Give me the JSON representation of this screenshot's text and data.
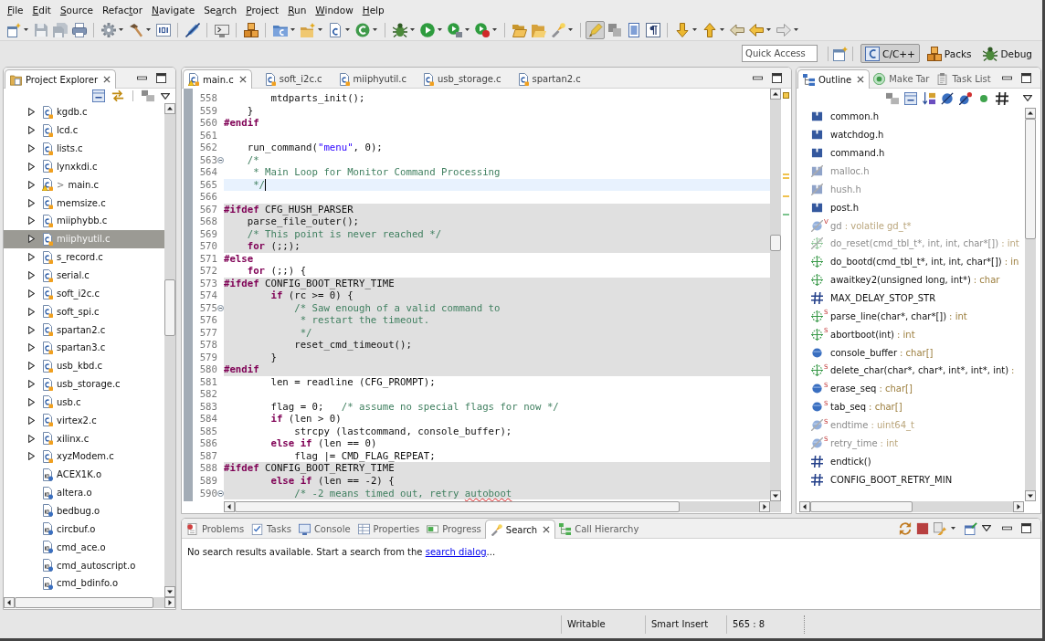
{
  "menu": [
    {
      "key": "F",
      "after": "ile"
    },
    {
      "key": "E",
      "after": "dit"
    },
    {
      "key": "S",
      "after": "ource"
    },
    {
      "before": "Refac",
      "key": "t",
      "after": "or"
    },
    {
      "key": "N",
      "after": "avigate"
    },
    {
      "before": "Se",
      "key": "a",
      "after": "rch"
    },
    {
      "key": "P",
      "after": "roject"
    },
    {
      "key": "R",
      "after": "un"
    },
    {
      "key": "W",
      "after": "indow"
    },
    {
      "key": "H",
      "after": "elp"
    }
  ],
  "toolbar": {
    "groups": [
      [
        {
          "kind": "new",
          "menu": true,
          "on": false
        },
        {
          "kind": "save",
          "menu": false,
          "on": false
        },
        {
          "kind": "saveall",
          "menu": false,
          "on": false
        },
        {
          "kind": "print",
          "menu": false,
          "on": false
        }
      ],
      [
        {
          "kind": "gear",
          "menu": true,
          "on": false
        },
        {
          "kind": "hammer",
          "menu": true,
          "on": false
        },
        {
          "kind": "binary",
          "menu": false,
          "on": false
        }
      ],
      [
        {
          "kind": "skip",
          "menu": false,
          "on": false
        }
      ],
      [
        {
          "kind": "remote",
          "menu": false,
          "on": false
        }
      ],
      [
        {
          "kind": "packs",
          "menu": false,
          "on": false
        }
      ],
      [
        {
          "kind": "cproject",
          "menu": true,
          "on": false
        },
        {
          "kind": "newfolder",
          "menu": true,
          "on": false
        },
        {
          "kind": "csource",
          "menu": true,
          "on": false
        },
        {
          "kind": "cclass",
          "menu": true,
          "on": false
        }
      ],
      [
        {
          "kind": "bug",
          "menu": true,
          "on": false
        },
        {
          "kind": "run",
          "menu": true,
          "on": false
        },
        {
          "kind": "runtool",
          "menu": true,
          "on": false
        },
        {
          "kind": "external",
          "menu": true,
          "on": false
        }
      ],
      [
        {
          "kind": "openfolder",
          "menu": false,
          "on": false
        },
        {
          "kind": "openfile",
          "menu": false,
          "on": false
        },
        {
          "kind": "torch",
          "menu": true,
          "on": false
        }
      ],
      [
        {
          "kind": "highlight",
          "menu": false,
          "on": true
        },
        {
          "kind": "block",
          "menu": false,
          "on": false
        },
        {
          "kind": "doc",
          "menu": false,
          "on": false
        },
        {
          "kind": "pilcrow",
          "menu": false,
          "on": false
        }
      ],
      [
        {
          "kind": "nextmark",
          "menu": true,
          "on": false
        },
        {
          "kind": "prevmark",
          "menu": true,
          "on": false
        },
        {
          "kind": "lastedit",
          "menu": false,
          "on": false
        },
        {
          "kind": "back",
          "menu": true,
          "on": false
        },
        {
          "kind": "forward",
          "menu": true,
          "on": false
        }
      ]
    ]
  },
  "quick_access": {
    "placeholder": "Quick Access"
  },
  "perspectives": [
    {
      "label": "C/C++",
      "kind": "c",
      "selected": true
    },
    {
      "label": "Packs",
      "kind": "packs",
      "selected": false
    },
    {
      "label": "Debug",
      "kind": "debug",
      "selected": false
    }
  ],
  "project_explorer": {
    "tabs": [
      {
        "label": "Project Explorer",
        "kind": "explorer",
        "selected": true
      }
    ],
    "items": [
      {
        "label": "kgdb.c",
        "kind": "source",
        "expanded": false,
        "warning": false,
        "selected": false
      },
      {
        "label": "lcd.c",
        "kind": "source",
        "expanded": false,
        "warning": false,
        "selected": false
      },
      {
        "label": "lists.c",
        "kind": "source",
        "expanded": false,
        "warning": false,
        "selected": false
      },
      {
        "label": "lynxkdi.c",
        "kind": "source",
        "expanded": false,
        "warning": false,
        "selected": false
      },
      {
        "prefix": ">",
        "label": "main.c",
        "kind": "source",
        "expanded": false,
        "warning": true,
        "selected": false
      },
      {
        "label": "memsize.c",
        "kind": "source",
        "expanded": false,
        "warning": false,
        "selected": false
      },
      {
        "label": "miiphybb.c",
        "kind": "source",
        "expanded": false,
        "warning": false,
        "selected": false
      },
      {
        "label": "miiphyutil.c",
        "kind": "source",
        "expanded": false,
        "warning": false,
        "selected": true
      },
      {
        "label": "s_record.c",
        "kind": "source",
        "expanded": false,
        "warning": false,
        "selected": false
      },
      {
        "label": "serial.c",
        "kind": "source",
        "expanded": false,
        "warning": false,
        "selected": false
      },
      {
        "label": "soft_i2c.c",
        "kind": "source",
        "expanded": false,
        "warning": false,
        "selected": false
      },
      {
        "label": "soft_spi.c",
        "kind": "source",
        "expanded": false,
        "warning": false,
        "selected": false
      },
      {
        "label": "spartan2.c",
        "kind": "source",
        "expanded": false,
        "warning": false,
        "selected": false
      },
      {
        "label": "spartan3.c",
        "kind": "source",
        "expanded": false,
        "warning": false,
        "selected": false
      },
      {
        "label": "usb_kbd.c",
        "kind": "source",
        "expanded": false,
        "warning": false,
        "selected": false
      },
      {
        "label": "usb_storage.c",
        "kind": "source",
        "expanded": false,
        "warning": false,
        "selected": false
      },
      {
        "label": "usb.c",
        "kind": "source",
        "expanded": false,
        "warning": false,
        "selected": false
      },
      {
        "label": "virtex2.c",
        "kind": "source",
        "expanded": false,
        "warning": false,
        "selected": false
      },
      {
        "label": "xilinx.c",
        "kind": "source",
        "expanded": false,
        "warning": false,
        "selected": false
      },
      {
        "label": "xyzModem.c",
        "kind": "source",
        "expanded": false,
        "warning": false,
        "selected": false
      },
      {
        "label": "ACEX1K.o",
        "kind": "object",
        "warning": false,
        "selected": false
      },
      {
        "label": "altera.o",
        "kind": "object",
        "warning": false,
        "selected": false
      },
      {
        "label": "bedbug.o",
        "kind": "object",
        "warning": false,
        "selected": false
      },
      {
        "label": "circbuf.o",
        "kind": "object",
        "warning": false,
        "selected": false
      },
      {
        "label": "cmd_ace.o",
        "kind": "object",
        "warning": false,
        "selected": false
      },
      {
        "label": "cmd_autoscript.o",
        "kind": "object",
        "warning": false,
        "selected": false
      },
      {
        "label": "cmd_bdinfo.o",
        "kind": "object",
        "warning": false,
        "selected": false
      }
    ]
  },
  "editor": {
    "tabs": [
      {
        "label": "main.c",
        "warning": true,
        "selected": true
      },
      {
        "label": "soft_i2c.c",
        "warning": false,
        "selected": false
      },
      {
        "label": "miiphyutil.c",
        "warning": false,
        "selected": false
      },
      {
        "label": "usb_storage.c",
        "warning": false,
        "selected": false
      },
      {
        "label": "spartan2.c",
        "warning": false,
        "selected": false
      }
    ],
    "lines": [
      {
        "number": "558",
        "segments": [
          {
            "kind": "plain",
            "text": "        mtdparts_init();"
          }
        ],
        "inactive": false,
        "current": false,
        "fold": false
      },
      {
        "number": "559",
        "segments": [
          {
            "kind": "plain",
            "text": "    }"
          }
        ],
        "inactive": false,
        "current": false,
        "fold": false
      },
      {
        "number": "560",
        "segments": [
          {
            "kind": "keyword",
            "text": "#endif"
          }
        ],
        "inactive": false,
        "current": false,
        "fold": false
      },
      {
        "number": "561",
        "inactive": false,
        "current": false,
        "fold": false
      },
      {
        "number": "562",
        "segments": [
          {
            "kind": "plain",
            "text": "    run_command("
          },
          {
            "kind": "string",
            "text": "\"menu\""
          },
          {
            "kind": "plain",
            "text": ", 0);"
          }
        ],
        "inactive": false,
        "current": false,
        "fold": false
      },
      {
        "number": "563",
        "segments": [
          {
            "kind": "comment",
            "text": "    /*"
          }
        ],
        "inactive": false,
        "current": false,
        "fold": true
      },
      {
        "number": "564",
        "segments": [
          {
            "kind": "comment",
            "text": "     * Main Loop for Monitor Command Processing"
          }
        ],
        "inactive": false,
        "current": false,
        "fold": false
      },
      {
        "number": "565",
        "segments": [
          {
            "kind": "comment",
            "text": "     */"
          }
        ],
        "inactive": false,
        "current": true,
        "fold": false
      },
      {
        "number": "566",
        "inactive": false,
        "current": false,
        "fold": false
      },
      {
        "number": "567",
        "segments": [
          {
            "kind": "keyword",
            "text": "#ifdef"
          },
          {
            "kind": "plain",
            "text": " CFG_HUSH_PARSER"
          }
        ],
        "inactive": true,
        "current": false,
        "fold": false
      },
      {
        "number": "568",
        "segments": [
          {
            "kind": "plain",
            "text": "    parse_file_outer();"
          }
        ],
        "inactive": true,
        "current": false,
        "fold": false
      },
      {
        "number": "569",
        "segments": [
          {
            "kind": "comment",
            "text": "    /* This point is never reached */"
          }
        ],
        "inactive": true,
        "current": false,
        "fold": false
      },
      {
        "number": "570",
        "segments": [
          {
            "kind": "keyword",
            "text": "    for"
          },
          {
            "kind": "plain",
            "text": " (;;);"
          }
        ],
        "inactive": true,
        "current": false,
        "fold": false
      },
      {
        "number": "571",
        "segments": [
          {
            "kind": "keyword",
            "text": "#else"
          }
        ],
        "inactive": false,
        "current": false,
        "fold": false
      },
      {
        "number": "572",
        "segments": [
          {
            "kind": "keyword",
            "text": "    for"
          },
          {
            "kind": "plain",
            "text": " (;;) {"
          }
        ],
        "inactive": false,
        "current": false,
        "fold": false
      },
      {
        "number": "573",
        "segments": [
          {
            "kind": "keyword",
            "text": "#ifdef"
          },
          {
            "kind": "plain",
            "text": " CONFIG_BOOT_RETRY_TIME"
          }
        ],
        "inactive": true,
        "current": false,
        "fold": false
      },
      {
        "number": "574",
        "segments": [
          {
            "kind": "keyword",
            "text": "        if"
          },
          {
            "kind": "plain",
            "text": " (rc >= 0) {"
          }
        ],
        "inactive": true,
        "current": false,
        "fold": false
      },
      {
        "number": "575",
        "segments": [
          {
            "kind": "comment",
            "text": "            /* Saw enough of a valid command to"
          }
        ],
        "inactive": true,
        "current": false,
        "fold": true
      },
      {
        "number": "576",
        "segments": [
          {
            "kind": "comment",
            "text": "             * restart the timeout."
          }
        ],
        "inactive": true,
        "current": false,
        "fold": false
      },
      {
        "number": "577",
        "segments": [
          {
            "kind": "comment",
            "text": "             */"
          }
        ],
        "inactive": true,
        "current": false,
        "fold": false
      },
      {
        "number": "578",
        "segments": [
          {
            "kind": "plain",
            "text": "            reset_cmd_timeout();"
          }
        ],
        "inactive": true,
        "current": false,
        "fold": false
      },
      {
        "number": "579",
        "segments": [
          {
            "kind": "plain",
            "text": "        }"
          }
        ],
        "inactive": true,
        "current": false,
        "fold": false
      },
      {
        "number": "580",
        "segments": [
          {
            "kind": "keyword",
            "text": "#endif"
          }
        ],
        "inactive": true,
        "current": false,
        "fold": false
      },
      {
        "number": "581",
        "segments": [
          {
            "kind": "plain",
            "text": "        len = readline (CFG_PROMPT);"
          }
        ],
        "inactive": false,
        "current": false,
        "fold": false
      },
      {
        "number": "582",
        "inactive": false,
        "current": false,
        "fold": false
      },
      {
        "number": "583",
        "segments": [
          {
            "kind": "plain",
            "text": "        flag = 0;   "
          },
          {
            "kind": "comment",
            "text": "/* assume no special flags for now */"
          }
        ],
        "inactive": false,
        "current": false,
        "fold": false
      },
      {
        "number": "584",
        "segments": [
          {
            "kind": "keyword",
            "text": "        if"
          },
          {
            "kind": "plain",
            "text": " (len > 0)"
          }
        ],
        "inactive": false,
        "current": false,
        "fold": false
      },
      {
        "number": "585",
        "segments": [
          {
            "kind": "plain",
            "text": "            strcpy (lastcommand, console_buffer);"
          }
        ],
        "inactive": false,
        "current": false,
        "fold": false
      },
      {
        "number": "586",
        "segments": [
          {
            "kind": "keyword",
            "text": "        else if"
          },
          {
            "kind": "plain",
            "text": " (len == 0)"
          }
        ],
        "inactive": false,
        "current": false,
        "fold": false
      },
      {
        "number": "587",
        "segments": [
          {
            "kind": "plain",
            "text": "            flag |= CMD_FLAG_REPEAT;"
          }
        ],
        "inactive": false,
        "current": false,
        "fold": false
      },
      {
        "number": "588",
        "segments": [
          {
            "kind": "keyword",
            "text": "#ifdef"
          },
          {
            "kind": "plain",
            "text": " CONFIG_BOOT_RETRY_TIME"
          }
        ],
        "inactive": true,
        "current": false,
        "fold": false
      },
      {
        "number": "589",
        "segments": [
          {
            "kind": "keyword",
            "text": "        else if"
          },
          {
            "kind": "plain",
            "text": " (len == -2) {"
          }
        ],
        "inactive": true,
        "current": false,
        "fold": false
      },
      {
        "number": "590",
        "segments": [
          {
            "kind": "comment",
            "text": "            /* -2 means timed out, retry "
          },
          {
            "kind": "misspelled",
            "text": "autoboot"
          }
        ],
        "inactive": true,
        "current": false,
        "fold": true
      }
    ],
    "overview_marks": [
      {
        "color": "#f0c24e"
      },
      {
        "color": "#f0c24e"
      },
      {
        "color": "#f0c24e"
      },
      {
        "color": "#7cc48e"
      }
    ]
  },
  "outline": {
    "tabs": [
      {
        "label": "Outline",
        "kind": "outline",
        "selected": true
      },
      {
        "label": "Make Tar",
        "kind": "make",
        "selected": false
      },
      {
        "label": "Task List",
        "kind": "tasklist",
        "selected": false
      }
    ],
    "items": [
      {
        "kind": "include",
        "name": "common.h",
        "inactive": false
      },
      {
        "kind": "include",
        "name": "watchdog.h",
        "inactive": false
      },
      {
        "kind": "include",
        "name": "command.h",
        "inactive": false
      },
      {
        "kind": "include",
        "name": "malloc.h",
        "inactive": true
      },
      {
        "kind": "include",
        "name": "hush.h",
        "inactive": true
      },
      {
        "kind": "include",
        "name": "post.h",
        "inactive": false
      },
      {
        "kind": "variable",
        "modifier": "V",
        "name": "gd",
        "type": ": volatile gd_t*",
        "inactive": true
      },
      {
        "kind": "function",
        "name": "do_reset(cmd_tbl_t*, int, int, char*[])",
        "type": ": int",
        "inactive": true
      },
      {
        "kind": "function",
        "name": "do_bootd(cmd_tbl_t*, int, int, char*[])",
        "type": ": in",
        "inactive": false
      },
      {
        "kind": "function",
        "name": "awaitkey2(unsigned long, int*)",
        "type": ": char",
        "inactive": false
      },
      {
        "kind": "macro",
        "name": "MAX_DELAY_STOP_STR",
        "inactive": false
      },
      {
        "kind": "function",
        "modifier": "S",
        "name": "parse_line(char*, char*[])",
        "type": ": int",
        "inactive": false
      },
      {
        "kind": "function",
        "modifier": "S",
        "name": "abortboot(int)",
        "type": ": int",
        "inactive": false
      },
      {
        "kind": "variable",
        "name": "console_buffer",
        "type": ": char[]",
        "inactive": false
      },
      {
        "kind": "function",
        "modifier": "S",
        "name": "delete_char(char*, char*, int*, int*, int)",
        "type": ":",
        "inactive": false
      },
      {
        "kind": "variable",
        "modifier": "S",
        "name": "erase_seq",
        "type": ": char[]",
        "inactive": false
      },
      {
        "kind": "variable",
        "modifier": "S",
        "name": "tab_seq",
        "type": ": char[]",
        "inactive": false
      },
      {
        "kind": "variable",
        "modifier": "S",
        "name": "endtime",
        "type": ": uint64_t",
        "inactive": true
      },
      {
        "kind": "variable",
        "modifier": "S",
        "name": "retry_time",
        "type": ": int",
        "inactive": true
      },
      {
        "kind": "macro",
        "name": "endtick()",
        "inactive": false
      },
      {
        "kind": "macro",
        "name": "CONFIG_BOOT_RETRY_MIN",
        "inactive": false
      }
    ]
  },
  "bottom_panel": {
    "tabs": [
      {
        "label": "Problems",
        "kind": "problems",
        "selected": false
      },
      {
        "label": "Tasks",
        "kind": "tasks",
        "selected": false
      },
      {
        "label": "Console",
        "kind": "console",
        "selected": false
      },
      {
        "label": "Properties",
        "kind": "properties",
        "selected": false
      },
      {
        "label": "Progress",
        "kind": "progress",
        "selected": false
      },
      {
        "label": "Search",
        "kind": "search",
        "selected": true
      },
      {
        "label": "Call Hierarchy",
        "kind": "hierarchy",
        "selected": false
      }
    ],
    "message": {
      "before": "No search results available. Start a search from the ",
      "link": "search dialog",
      "after": "..."
    }
  },
  "status_bar": [
    "Writable",
    "Smart Insert",
    "565 : 8"
  ]
}
